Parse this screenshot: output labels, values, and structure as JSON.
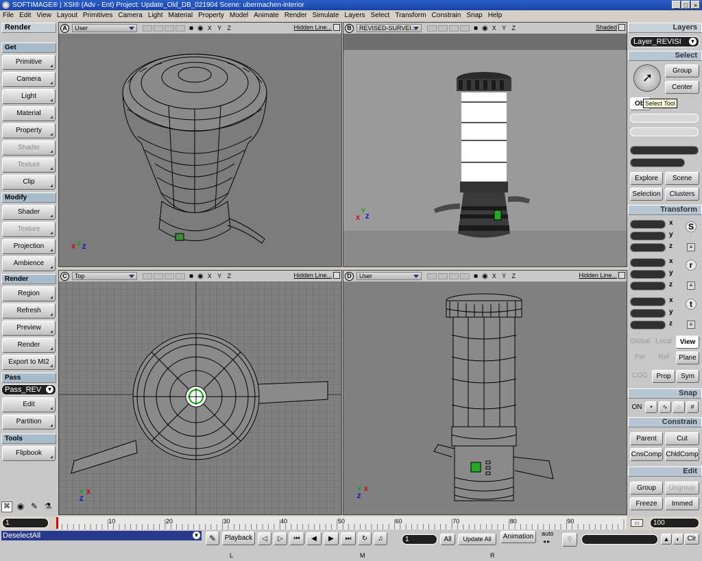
{
  "titlebar": {
    "text": "SOFTIMAGE® | XSI® (Adv - Ent) Project: Update_Old_DB_021904    Scene: ubermachen-interior",
    "min": "_",
    "max": "□",
    "close": "×"
  },
  "menubar": [
    "File",
    "Edit",
    "View",
    "Layout",
    "Primitives",
    "Camera",
    "Light",
    "Material",
    "Property",
    "Model",
    "Animate",
    "Render",
    "Simulate",
    "Layers",
    "Select",
    "Transform",
    "Constrain",
    "Snap",
    "Help"
  ],
  "left": {
    "top_title": "Render",
    "get_header": "Get",
    "get_buttons": [
      "Primitive",
      "Camera",
      "Light",
      "Material",
      "Property",
      "Shader",
      "Texture",
      "Clip"
    ],
    "modify_header": "Modify",
    "modify_buttons": [
      "Shader",
      "Texture",
      "Projection",
      "Ambience"
    ],
    "render_header": "Render",
    "render_buttons": [
      "Region",
      "Refresh",
      "Preview",
      "Render",
      "Export to MI2"
    ],
    "pass_header": "Pass",
    "pass_select": "Pass_REV",
    "pass_buttons": [
      "Edit",
      "Partition"
    ],
    "tools_header": "Tools",
    "tools_buttons": [
      "Flipbook"
    ]
  },
  "viewports": {
    "a": {
      "letter": "A",
      "camera": "User",
      "mode": "Hidden Line..."
    },
    "b": {
      "letter": "B",
      "camera": "REVISED-SURVEI...",
      "mode": "Shaded"
    },
    "c": {
      "letter": "C",
      "camera": "Top",
      "mode": "Hidden Line..."
    },
    "d": {
      "letter": "D",
      "camera": "User",
      "mode": "Hidden Line..."
    }
  },
  "axis_labels": {
    "x": "X",
    "y": "Y",
    "z": "Z"
  },
  "right": {
    "layers_header": "Layers",
    "layer_select": "Layer_REVISI",
    "select_header": "Select",
    "group_button": "Group",
    "center_button": "Center",
    "object_button": "Ob",
    "tooltip": "Select Tool",
    "explore_button": "Explore",
    "scene_button": "Scene",
    "selection_button": "Selection",
    "clusters_button": "Clusters",
    "transform_header": "Transform",
    "axis_x": "x",
    "axis_y": "y",
    "axis_z": "z",
    "global_button": "Global",
    "local_button": "Local",
    "view_button": "View",
    "par_button": "Par",
    "ref_button": "Ref",
    "plane_button": "Plane",
    "cog_button": "COG",
    "prop_button": "Prop",
    "sym_button": "Sym",
    "snap_header": "Snap",
    "snap_on": "ON",
    "constrain_header": "Constrain",
    "parent_button": "Parent",
    "cut_button": "Cut",
    "cnscomp_button": "CnsComp",
    "chldcomp_button": "ChldComp",
    "edit_header": "Edit",
    "edit_group_button": "Group",
    "ungroup_button": "Ungroup",
    "freeze_button": "Freeze",
    "immed_button": "Immed"
  },
  "timeline": {
    "start": "1",
    "end": "100",
    "current_frame": 1,
    "ticks": [
      "10",
      "20",
      "30",
      "40",
      "50",
      "60",
      "70",
      "80",
      "90"
    ]
  },
  "bottom": {
    "command": "DeselectAll",
    "playback_button": "Playback",
    "frame_field": "1",
    "all_button": "All",
    "update_all_button": "Update All",
    "animation_button": "Animation",
    "auto_label": "auto",
    "clr_button": "Clr",
    "mouse_l": "L",
    "mouse_m": "M",
    "mouse_r": "R"
  }
}
